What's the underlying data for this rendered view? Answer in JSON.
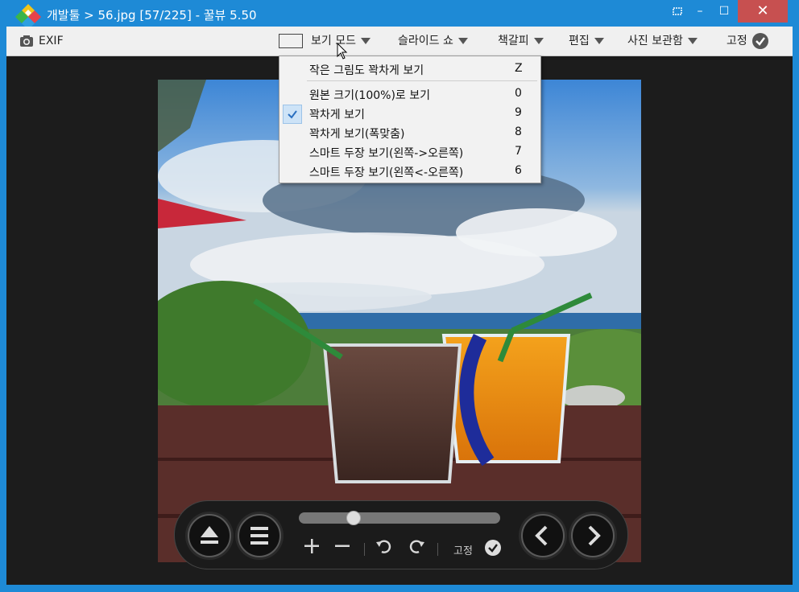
{
  "window": {
    "title": "개발툴 > 56.jpg [57/225] - 꿀뷰 5.50",
    "minimize": "–",
    "maximize": "☐",
    "close": "✕"
  },
  "toolbar": {
    "exif": "EXIF",
    "view_mode": "보기 모드",
    "slideshow": "슬라이드 쇼",
    "bookmark": "책갈피",
    "edit": "편집",
    "photo_album": "사진 보관함",
    "pin": "고정"
  },
  "view_menu": {
    "items": [
      {
        "label": "작은 그림도 꽉차게 보기",
        "key": "Z",
        "checked": false
      },
      {
        "label": "원본 크기(100%)로 보기",
        "key": "0",
        "checked": false
      },
      {
        "label": "꽉차게 보기",
        "key": "9",
        "checked": true
      },
      {
        "label": "꽉차게 보기(폭맞춤)",
        "key": "8",
        "checked": false
      },
      {
        "label": "스마트 두장 보기(왼쪽->오른쪽)",
        "key": "7",
        "checked": false
      },
      {
        "label": "스마트 두장 보기(왼쪽<-오른쪽)",
        "key": "6",
        "checked": false
      }
    ]
  },
  "controls": {
    "pin_label": "고정",
    "slider_position": 0.25,
    "icons": [
      "eject-icon",
      "list-icon",
      "zoom-in-icon",
      "zoom-out-icon",
      "rotate-left-icon",
      "rotate-right-icon",
      "check-icon",
      "prev-icon",
      "next-icon"
    ]
  },
  "colors": {
    "titlebar": "#1e8ad6",
    "close_button": "#c75050",
    "toolbar": "#f0f0f0",
    "viewer_bg": "#1c1c1c"
  }
}
